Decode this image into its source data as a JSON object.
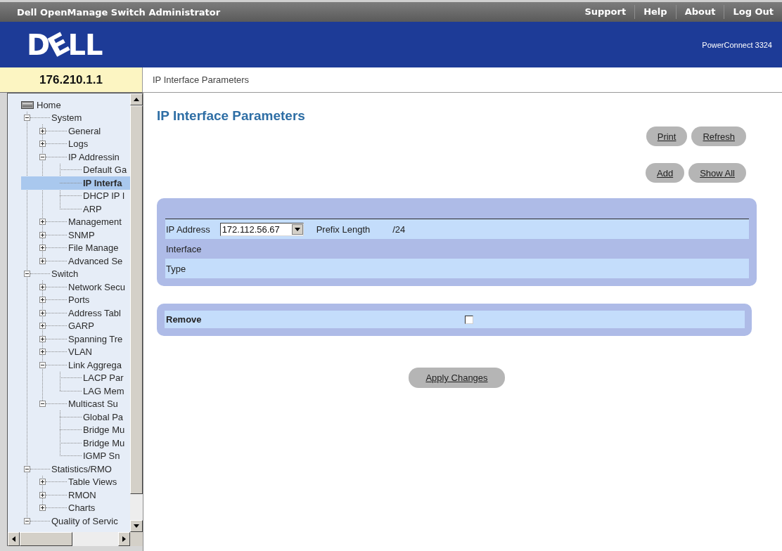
{
  "header": {
    "title": "Dell OpenManage Switch Administrator",
    "links": [
      "Support",
      "Help",
      "About",
      "Log Out"
    ]
  },
  "banner": {
    "logo": "DELL",
    "product": "PowerConnect 3324"
  },
  "device_address": "176.210.1.1",
  "breadcrumb": "IP Interface Parameters",
  "tree": [
    {
      "label": "Home",
      "selected": false,
      "children": [
        {
          "label": "System",
          "expanded": true,
          "selected": false,
          "children": [
            {
              "label": "General",
              "expanded": false,
              "selected": false
            },
            {
              "label": "Logs",
              "expanded": false,
              "selected": false
            },
            {
              "label": "IP Addressin",
              "expanded": true,
              "selected": false,
              "children": [
                {
                  "label": "Default Ga",
                  "selected": false
                },
                {
                  "label": "IP Interfa",
                  "selected": true
                },
                {
                  "label": "DHCP IP I",
                  "selected": false
                },
                {
                  "label": "ARP",
                  "selected": false
                }
              ]
            },
            {
              "label": "Management",
              "expanded": false,
              "selected": false
            },
            {
              "label": "SNMP",
              "expanded": false,
              "selected": false
            },
            {
              "label": "File Manage",
              "expanded": false,
              "selected": false
            },
            {
              "label": "Advanced Se",
              "expanded": false,
              "selected": false
            }
          ]
        },
        {
          "label": "Switch",
          "expanded": true,
          "selected": false,
          "children": [
            {
              "label": "Network Secu",
              "expanded": false,
              "selected": false
            },
            {
              "label": "Ports",
              "expanded": false,
              "selected": false
            },
            {
              "label": "Address Tabl",
              "expanded": false,
              "selected": false
            },
            {
              "label": "GARP",
              "expanded": false,
              "selected": false
            },
            {
              "label": "Spanning Tre",
              "expanded": false,
              "selected": false
            },
            {
              "label": "VLAN",
              "expanded": false,
              "selected": false
            },
            {
              "label": "Link Aggrega",
              "expanded": true,
              "selected": false,
              "children": [
                {
                  "label": "LACP Par",
                  "selected": false
                },
                {
                  "label": "LAG Mem",
                  "selected": false
                }
              ]
            },
            {
              "label": "Multicast Su",
              "expanded": true,
              "selected": false,
              "children": [
                {
                  "label": "Global Pa",
                  "selected": false
                },
                {
                  "label": "Bridge Mu",
                  "selected": false
                },
                {
                  "label": "Bridge Mu",
                  "selected": false
                },
                {
                  "label": "IGMP Sn",
                  "selected": false
                }
              ]
            }
          ]
        },
        {
          "label": "Statistics/RMO",
          "expanded": true,
          "selected": false,
          "children": [
            {
              "label": "Table Views",
              "expanded": false,
              "selected": false
            },
            {
              "label": "RMON",
              "expanded": false,
              "selected": false
            },
            {
              "label": "Charts",
              "expanded": false,
              "selected": false
            }
          ]
        },
        {
          "label": "Quality of Servic",
          "expanded": true,
          "selected": false
        }
      ]
    }
  ],
  "page": {
    "title": "IP Interface Parameters",
    "button_rows": [
      [
        "Print",
        "Refresh"
      ],
      [
        "Add",
        "Show All"
      ]
    ]
  },
  "ip_panel": {
    "rows": [
      {
        "fields": [
          {
            "kind": "select",
            "label": "IP Address",
            "value": "172.112.56.67"
          },
          {
            "kind": "text",
            "label": "Prefix Length",
            "value": "/24"
          }
        ]
      },
      {
        "fields": [
          {
            "kind": "text",
            "label": "Interface"
          }
        ]
      },
      {
        "fields": [
          {
            "kind": "text",
            "label": "Type"
          }
        ]
      }
    ]
  },
  "remove": {
    "label": "Remove",
    "checked": false
  },
  "apply_button": "Apply Changes"
}
